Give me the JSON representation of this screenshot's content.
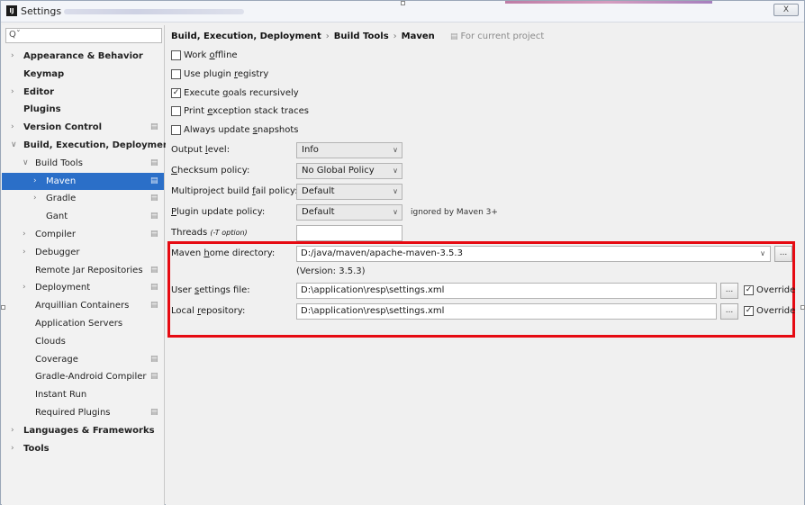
{
  "window": {
    "title": "Settings",
    "close_label": "X",
    "app_icon": "IJ"
  },
  "search": {
    "placeholder": "Qˇ",
    "icon": "search-icon"
  },
  "sidebar": {
    "items": [
      {
        "label": "Appearance & Behavior",
        "bold": true,
        "arrow": "›",
        "level": 0,
        "project": false
      },
      {
        "label": "Keymap",
        "bold": true,
        "arrow": "",
        "level": 0,
        "project": false
      },
      {
        "label": "Editor",
        "bold": true,
        "arrow": "›",
        "level": 0,
        "project": false
      },
      {
        "label": "Plugins",
        "bold": true,
        "arrow": "",
        "level": 0,
        "project": false
      },
      {
        "label": "Version Control",
        "bold": true,
        "arrow": "›",
        "level": 0,
        "project": true
      },
      {
        "label": "Build, Execution, Deployment",
        "bold": true,
        "arrow": "∨",
        "level": 0,
        "project": false
      },
      {
        "label": "Build Tools",
        "bold": false,
        "arrow": "∨",
        "level": 1,
        "project": true
      },
      {
        "label": "Maven",
        "bold": false,
        "arrow": "›",
        "level": 2,
        "project": true,
        "selected": true
      },
      {
        "label": "Gradle",
        "bold": false,
        "arrow": "›",
        "level": 2,
        "project": true
      },
      {
        "label": "Gant",
        "bold": false,
        "arrow": "",
        "level": 2,
        "project": true
      },
      {
        "label": "Compiler",
        "bold": false,
        "arrow": "›",
        "level": 1,
        "project": true
      },
      {
        "label": "Debugger",
        "bold": false,
        "arrow": "›",
        "level": 1,
        "project": false
      },
      {
        "label": "Remote Jar Repositories",
        "bold": false,
        "arrow": "",
        "level": 1,
        "project": true
      },
      {
        "label": "Deployment",
        "bold": false,
        "arrow": "›",
        "level": 1,
        "project": true
      },
      {
        "label": "Arquillian Containers",
        "bold": false,
        "arrow": "",
        "level": 1,
        "project": true
      },
      {
        "label": "Application Servers",
        "bold": false,
        "arrow": "",
        "level": 1,
        "project": false
      },
      {
        "label": "Clouds",
        "bold": false,
        "arrow": "",
        "level": 1,
        "project": false
      },
      {
        "label": "Coverage",
        "bold": false,
        "arrow": "",
        "level": 1,
        "project": true
      },
      {
        "label": "Gradle-Android Compiler",
        "bold": false,
        "arrow": "",
        "level": 1,
        "project": true
      },
      {
        "label": "Instant Run",
        "bold": false,
        "arrow": "",
        "level": 1,
        "project": false
      },
      {
        "label": "Required Plugins",
        "bold": false,
        "arrow": "",
        "level": 1,
        "project": true
      },
      {
        "label": "Languages & Frameworks",
        "bold": true,
        "arrow": "›",
        "level": 0,
        "project": false
      },
      {
        "label": "Tools",
        "bold": true,
        "arrow": "›",
        "level": 0,
        "project": false
      }
    ]
  },
  "breadcrumb": {
    "parts": [
      "Build, Execution, Deployment",
      "Build Tools",
      "Maven"
    ],
    "separator": "›",
    "for_current_project": "For current project"
  },
  "checkboxes": [
    {
      "pre": "Work ",
      "key": "o",
      "post": "ffline",
      "checked": false
    },
    {
      "pre": "Use plugin ",
      "key": "r",
      "post": "egistry",
      "checked": false
    },
    {
      "pre": "Execute ",
      "key": "g",
      "post": "oals recursively",
      "checked": true
    },
    {
      "pre": "Print ",
      "key": "e",
      "post": "xception stack traces",
      "checked": false
    },
    {
      "pre": "Always update ",
      "key": "s",
      "post": "napshots",
      "checked": false
    }
  ],
  "fields": {
    "output_level": {
      "pre": "Output ",
      "key": "l",
      "post": "evel:",
      "value": "Info"
    },
    "checksum_policy": {
      "pre": "",
      "key": "C",
      "post": "hecksum policy:",
      "value": "No Global Policy"
    },
    "multiproject_policy": {
      "pre": "Multiproject build ",
      "key": "f",
      "post": "ail policy:",
      "value": "Default"
    },
    "plugin_update_policy": {
      "pre": "",
      "key": "P",
      "post": "lugin update policy:",
      "value": "Default",
      "note": "ignored by Maven 3+"
    },
    "threads": {
      "label": "Threads",
      "hint": "(-T option)",
      "value": ""
    }
  },
  "maven": {
    "home_label": {
      "pre": "Maven ",
      "key": "h",
      "post": "ome directory:"
    },
    "home_value": "D:/java/maven/apache-maven-3.5.3",
    "version": "(Version: 3.5.3)",
    "user_settings_label": {
      "pre": "User ",
      "key": "s",
      "post": "ettings file:"
    },
    "user_settings_value": "D:\\application\\resp\\settings.xml",
    "local_repo_label": {
      "pre": "Local ",
      "key": "r",
      "post": "epository:"
    },
    "local_repo_value": "D:\\application\\resp\\settings.xml",
    "override_label": "Override",
    "browse_label": "..."
  },
  "colors": {
    "selection": "#2b6fc8",
    "highlight_box": "#e60a12"
  }
}
